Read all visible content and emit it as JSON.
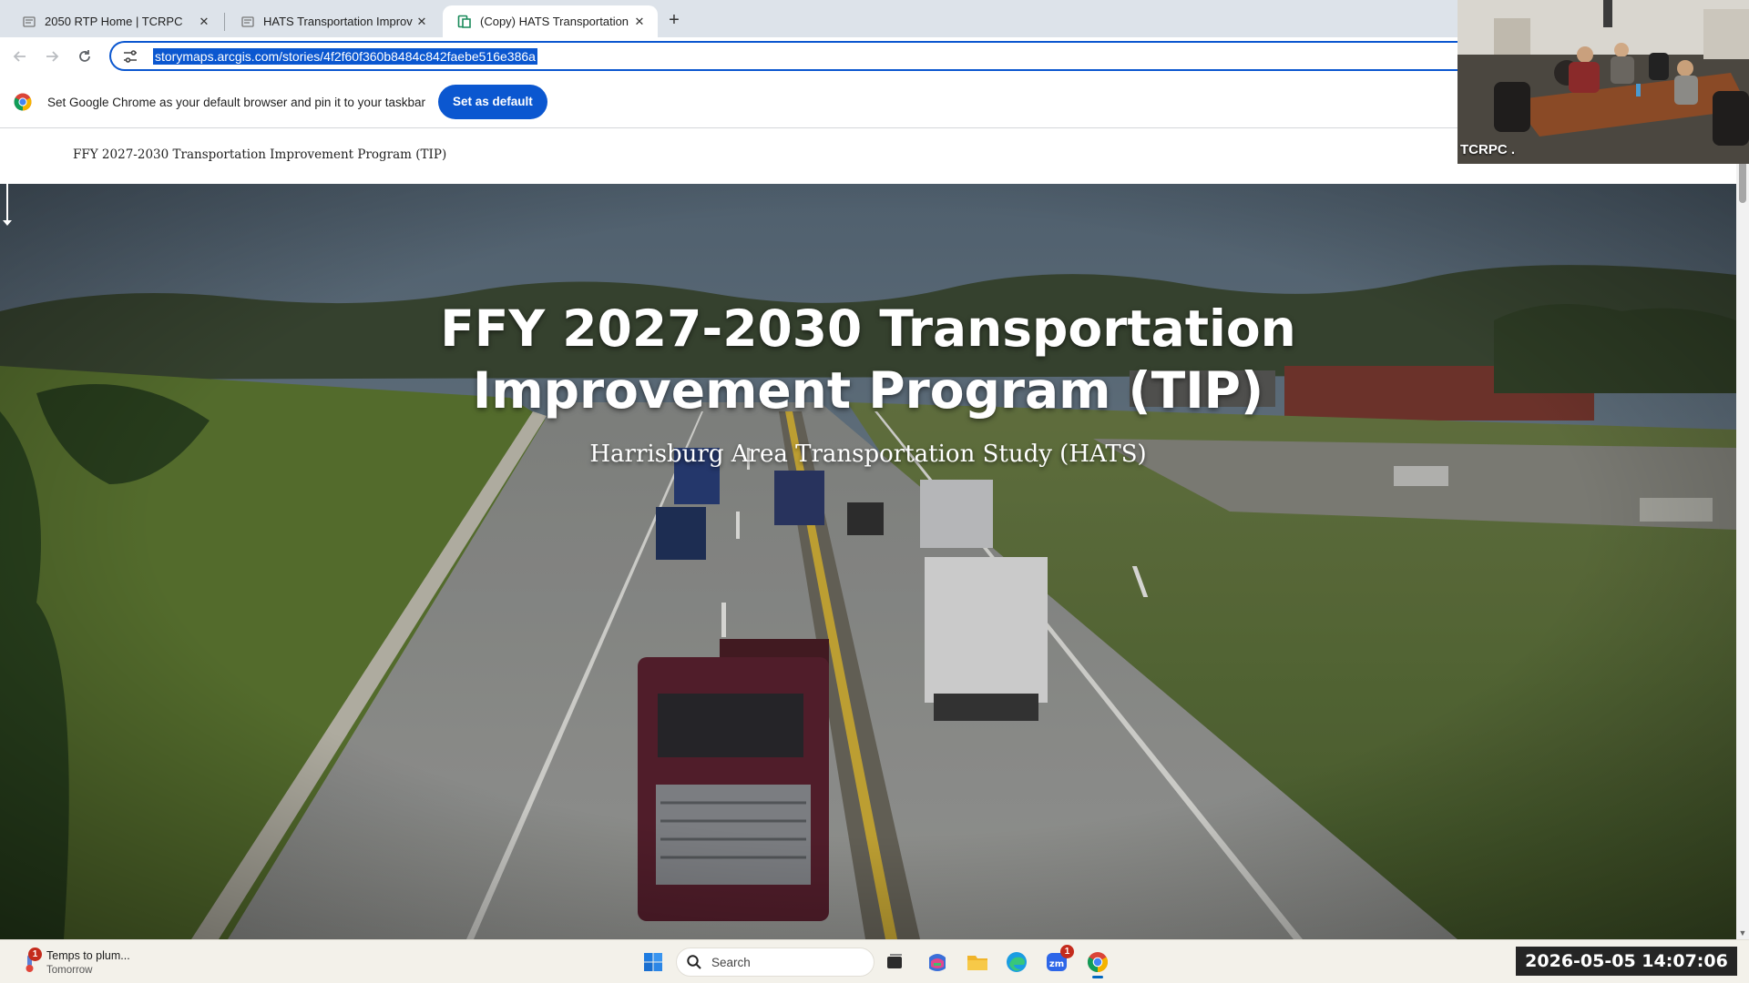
{
  "browser": {
    "tabs": [
      {
        "title": "2050 RTP Home | TCRPC",
        "icon": "document-icon",
        "active": false
      },
      {
        "title": "HATS Transportation Improvem",
        "icon": "document-icon",
        "active": false
      },
      {
        "title": "(Copy) HATS Transportation Im",
        "icon": "storymaps-icon",
        "active": true
      }
    ],
    "new_tab_label": "+",
    "close_glyph": "✕",
    "url": "storymaps.arcgis.com/stories/4f2f60f360b8484c842faebe516e386a",
    "infobar": {
      "message": "Set Google Chrome as your default browser and pin it to your taskbar",
      "button": "Set as default"
    }
  },
  "story": {
    "header_title": "FFY 2027-2030 Transportation Improvement Program (TIP)",
    "hero_title_line1": "FFY 2027-2030 Transportation",
    "hero_title_line2": "Improvement Program (TIP)",
    "hero_subtitle": "Harrisburg Area Transportation Study (HATS)"
  },
  "video_overlay": {
    "label": "TCRPC ."
  },
  "taskbar": {
    "weather": {
      "badge": "1",
      "line1": "Temps to plum...",
      "line2": "Tomorrow"
    },
    "search_placeholder": "Search",
    "zoom_badge": "1",
    "apps": [
      "windows-start-icon",
      "search-icon",
      "task-view-icon",
      "m365-copilot-icon",
      "file-explorer-icon",
      "edge-icon",
      "zoom-icon",
      "chrome-icon"
    ]
  },
  "timestamp": "2026-05-05 14:07:06",
  "colors": {
    "accent": "#0b57d0",
    "tabstrip": "#dde3ea",
    "taskbar": "#f3f1ea"
  }
}
